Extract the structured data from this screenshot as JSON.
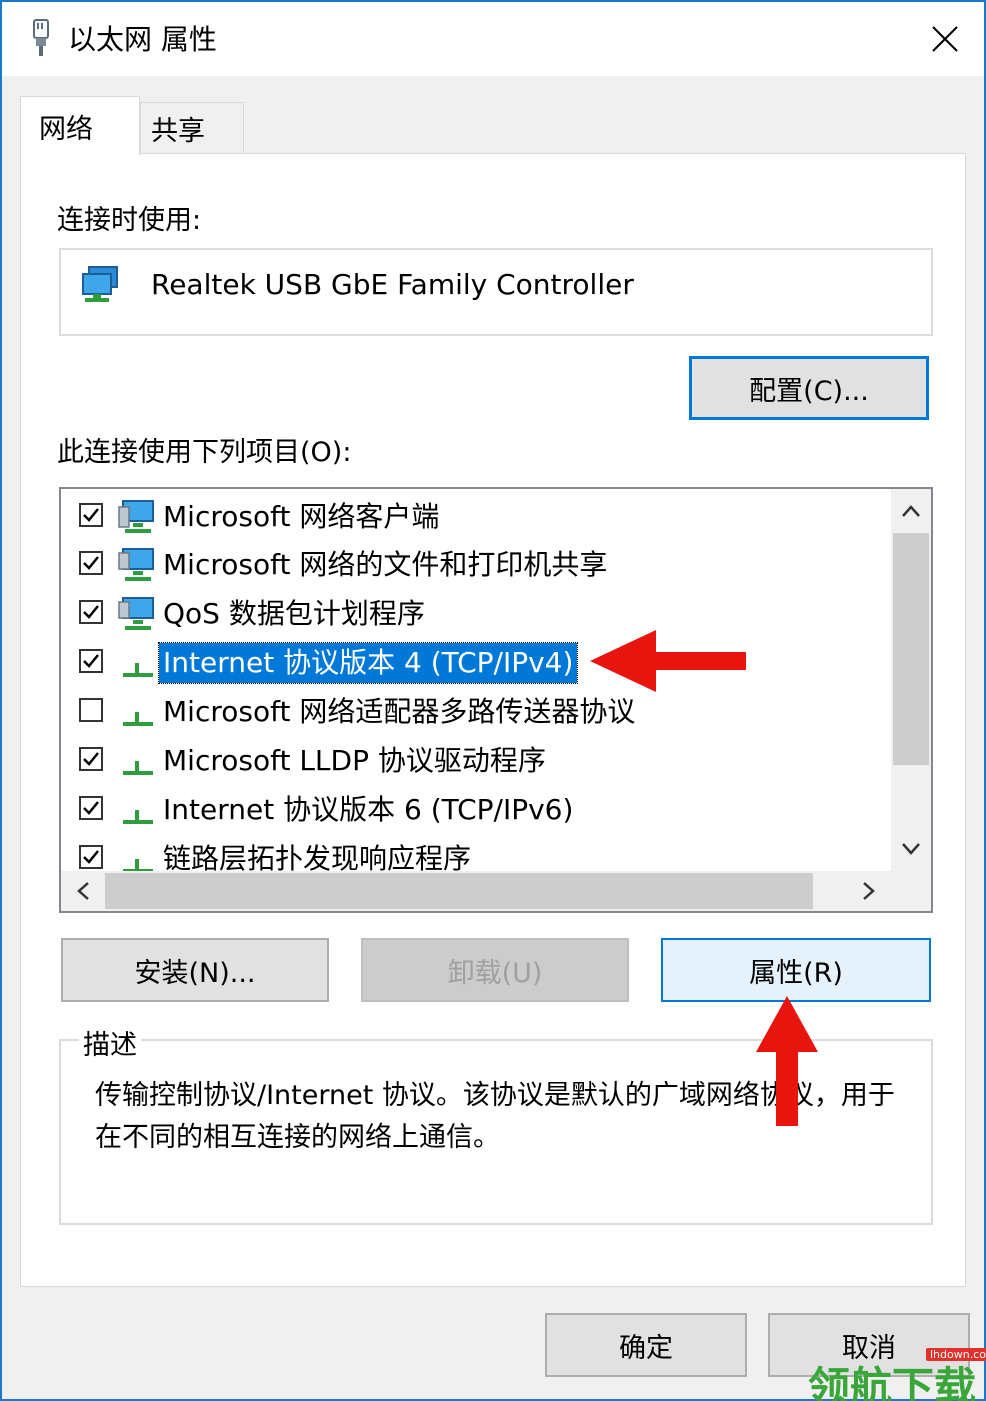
{
  "window": {
    "title": "以太网 属性"
  },
  "tabs": [
    {
      "label": "网络",
      "active": true
    },
    {
      "label": "共享",
      "active": false
    }
  ],
  "connect_using": {
    "label": "连接时使用:",
    "adapter": "Realtek USB GbE Family Controller",
    "configure_button": "配置(C)..."
  },
  "items_section": {
    "label": "此连接使用下列项目(O):",
    "items": [
      {
        "label": "Microsoft 网络客户端",
        "checked": true,
        "icon": "network-client-icon"
      },
      {
        "label": "Microsoft 网络的文件和打印机共享",
        "checked": true,
        "icon": "file-printer-sharing-icon"
      },
      {
        "label": "QoS 数据包计划程序",
        "checked": true,
        "icon": "qos-scheduler-icon"
      },
      {
        "label": "Internet 协议版本 4 (TCP/IPv4)",
        "checked": true,
        "icon": "protocol-icon",
        "selected": true
      },
      {
        "label": "Microsoft 网络适配器多路传送器协议",
        "checked": false,
        "icon": "protocol-icon"
      },
      {
        "label": "Microsoft LLDP 协议驱动程序",
        "checked": true,
        "icon": "protocol-icon"
      },
      {
        "label": "Internet 协议版本 6 (TCP/IPv6)",
        "checked": true,
        "icon": "protocol-icon"
      },
      {
        "label": "链路层拓扑发现响应程序",
        "checked": true,
        "icon": "protocol-icon"
      }
    ]
  },
  "action_buttons": {
    "install": "安装(N)...",
    "uninstall": "卸载(U)",
    "properties": "属性(R)"
  },
  "description": {
    "legend": "描述",
    "text": "传输控制协议/Internet 协议。该协议是默认的广域网络协议，用于在不同的相互连接的网络上通信。"
  },
  "footer": {
    "ok": "确定",
    "cancel": "取消"
  },
  "watermark": {
    "site": "lhdown.com",
    "text": "领航下载"
  },
  "colors": {
    "accent": "#0078d7",
    "annotation_arrow": "#e8150f",
    "window_border": "#1979ca"
  }
}
